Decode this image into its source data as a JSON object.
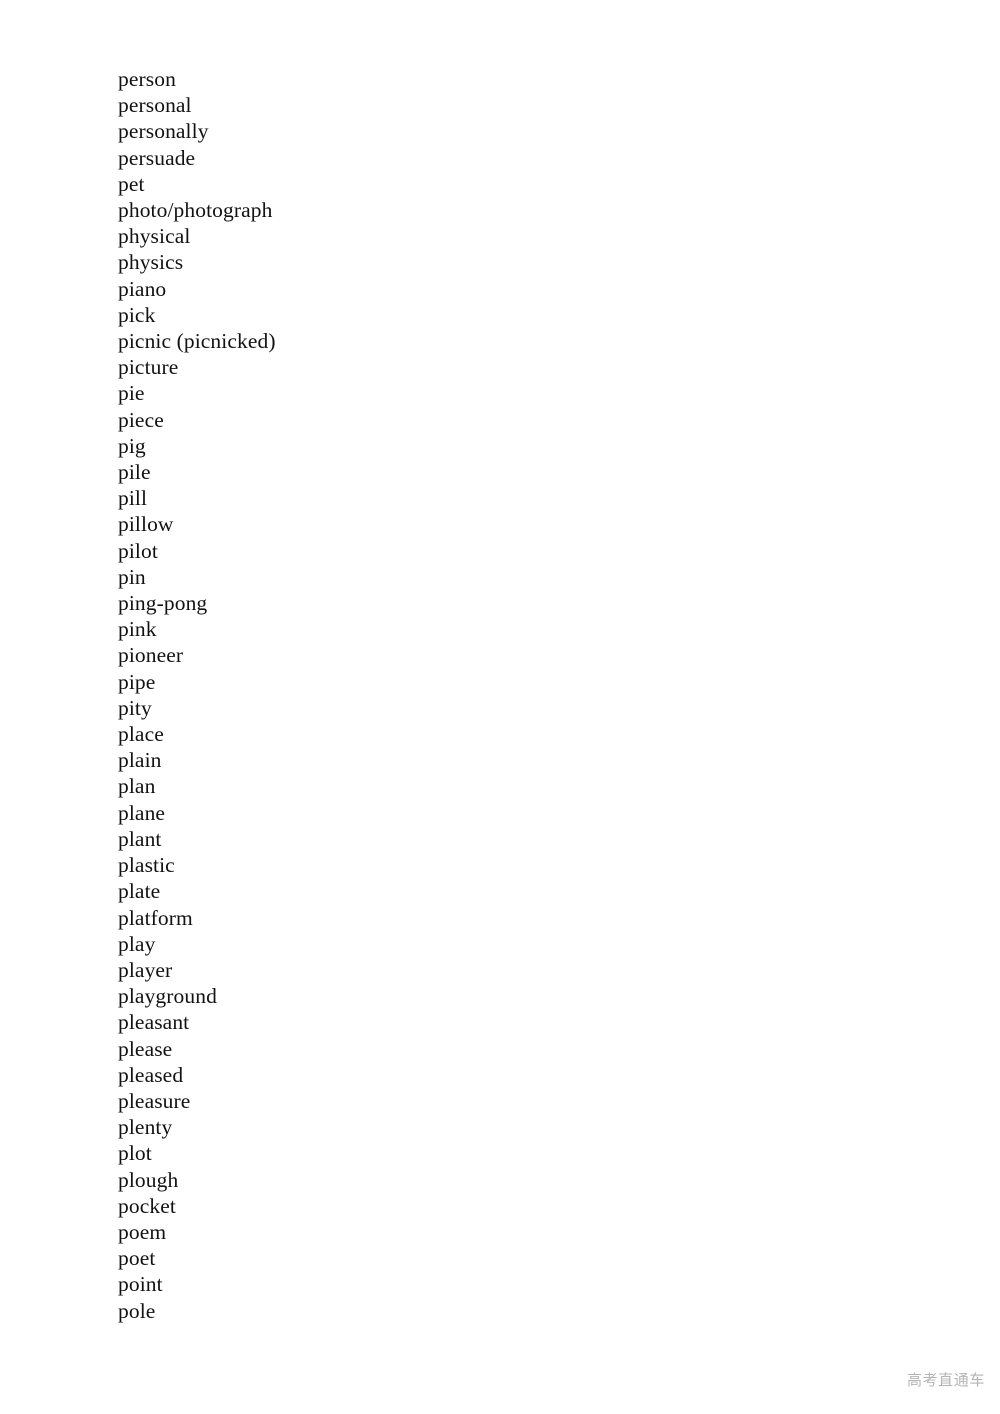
{
  "document": {
    "type": "vocabulary-word-list",
    "page_background": "#ffffff",
    "text_color": "#121212",
    "words": [
      "person",
      "personal",
      "personally",
      "persuade",
      "pet",
      "photo/photograph",
      "physical",
      "physics",
      "piano",
      "pick",
      "picnic (picnicked)",
      "picture",
      "pie",
      "piece",
      "pig",
      "pile",
      "pill",
      "pillow",
      "pilot",
      "pin",
      "ping-pong",
      "pink",
      "pioneer",
      "pipe",
      "pity",
      "place",
      "plain",
      "plan",
      "plane",
      "plant",
      "plastic",
      "plate",
      "platform",
      "play",
      "player",
      "playground",
      "pleasant",
      "please",
      "pleased",
      "pleasure",
      "plenty",
      "plot",
      "plough",
      "pocket",
      "poem",
      "poet",
      "point",
      "pole"
    ]
  },
  "watermark": {
    "text": "高考直通车",
    "color": "#b4b4b4"
  }
}
